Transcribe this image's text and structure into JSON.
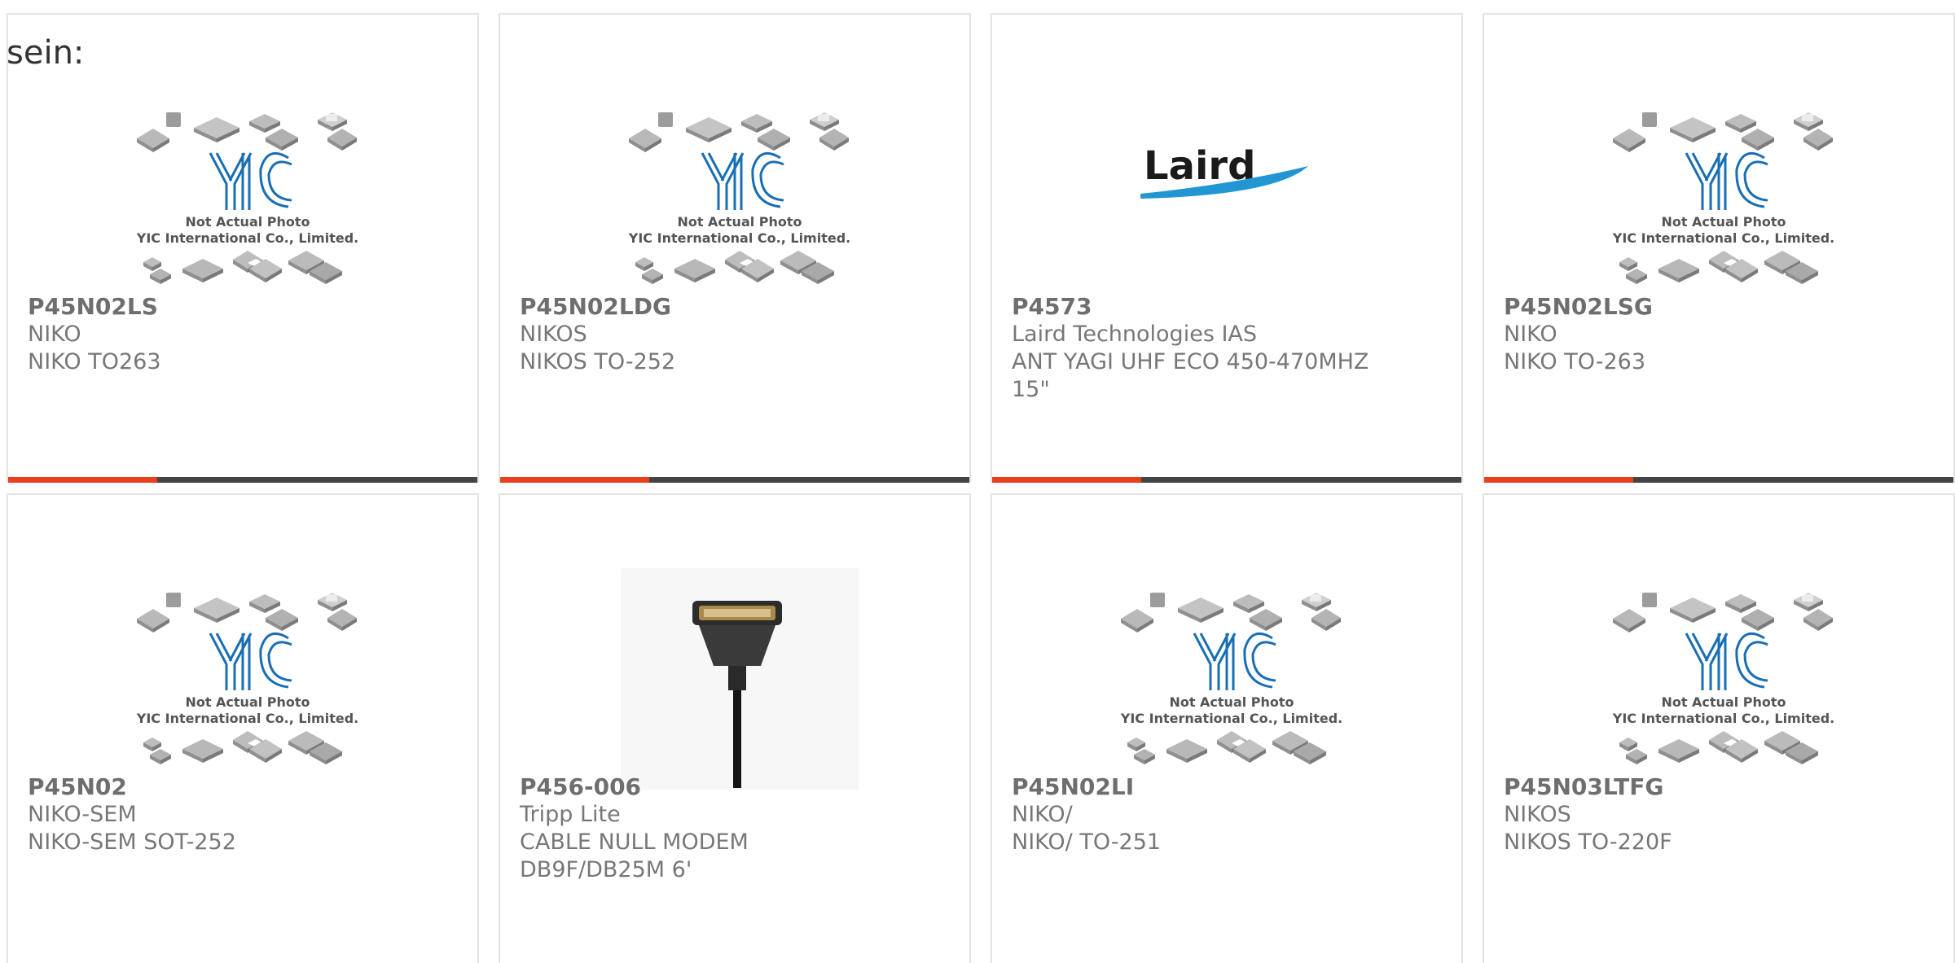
{
  "lead_text": "sein:",
  "accent_color": "#e8401c",
  "placeholder": {
    "logo": "YIC",
    "line1": "Not Actual Photo",
    "line2": "YIC International Co., Limited."
  },
  "products": [
    {
      "part": "P45N02LS",
      "lines": [
        "NIKO",
        "NIKO TO263"
      ],
      "image": "placeholder"
    },
    {
      "part": "P45N02LDG",
      "lines": [
        "NIKOS",
        "NIKOS TO-252"
      ],
      "image": "placeholder"
    },
    {
      "part": "P4573",
      "lines": [
        "Laird Technologies IAS",
        "ANT YAGI UHF ECO 450-470MHZ",
        "15\""
      ],
      "image": "laird",
      "brand": "Laird"
    },
    {
      "part": "P45N02LSG",
      "lines": [
        "NIKO",
        "NIKO TO-263"
      ],
      "image": "placeholder"
    },
    {
      "part": "P45N02",
      "lines": [
        "NIKO-SEM",
        "NIKO-SEM SOT-252"
      ],
      "image": "placeholder"
    },
    {
      "part": "P456-006",
      "lines": [
        "Tripp Lite",
        "CABLE NULL MODEM",
        "DB9F/DB25M 6'"
      ],
      "image": "cable"
    },
    {
      "part": "P45N02LI",
      "lines": [
        "NIKO/",
        "NIKO/ TO-251"
      ],
      "image": "placeholder"
    },
    {
      "part": "P45N03LTFG",
      "lines": [
        "NIKOS",
        "NIKOS TO-220F"
      ],
      "image": "placeholder"
    }
  ]
}
